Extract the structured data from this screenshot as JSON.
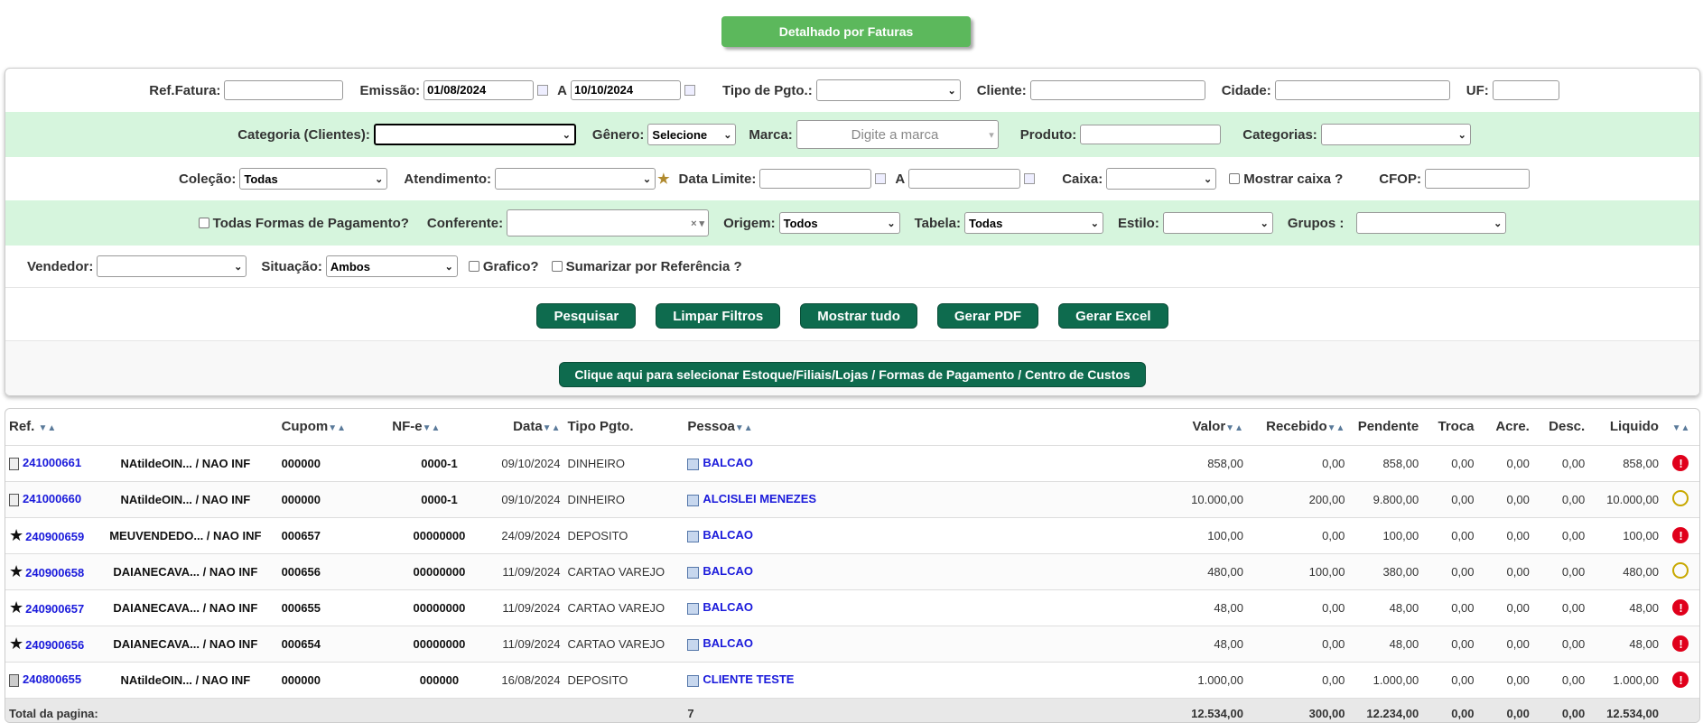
{
  "top_button": "Detalhado por Faturas",
  "filters": {
    "ref_fatura": "Ref.Fatura:",
    "emissao": "Emissão:",
    "emissao_de": "01/08/2024",
    "a": "A",
    "emissao_ate": "10/10/2024",
    "tipo_pgto": "Tipo de Pgto.:",
    "cliente": "Cliente:",
    "cidade": "Cidade:",
    "uf": "UF:",
    "categoria_clientes": "Categoria (Clientes):",
    "genero": "Gênero:",
    "genero_value": "Selecione",
    "marca": "Marca:",
    "marca_placeholder": "Digite a marca",
    "produto": "Produto:",
    "categorias": "Categorias:",
    "colecao": "Coleção:",
    "colecao_value": "Todas",
    "atendimento": "Atendimento:",
    "data_limite": "Data Limite:",
    "caixa": "Caixa:",
    "mostrar_caixa": "Mostrar caixa ?",
    "cfop": "CFOP:",
    "todas_formas": "Todas Formas de Pagamento?",
    "conferente": "Conferente:",
    "origem": "Origem:",
    "origem_value": "Todos",
    "tabela": "Tabela:",
    "tabela_value": "Todas",
    "estilo": "Estilo:",
    "grupos": "Grupos :",
    "vendedor": "Vendedor:",
    "situacao": "Situação:",
    "situacao_value": "Ambos",
    "grafico": "Grafico?",
    "sumarizar": "Sumarizar por Referência ?"
  },
  "actions": {
    "pesquisar": "Pesquisar",
    "limpar": "Limpar Filtros",
    "mostrar_tudo": "Mostrar tudo",
    "gerar_pdf": "Gerar PDF",
    "gerar_excel": "Gerar Excel",
    "selecionar": "Clique aqui para selecionar Estoque/Filiais/Lojas / Formas de Pagamento / Centro de Custos"
  },
  "table": {
    "headers": {
      "ref": "Ref.",
      "cupom": "Cupom",
      "nfe": "NF-e",
      "data": "Data",
      "tipo": "Tipo Pgto.",
      "pessoa": "Pessoa",
      "valor": "Valor",
      "recebido": "Recebido",
      "pendente": "Pendente",
      "troca": "Troca",
      "acre": "Acre.",
      "desc": "Desc.",
      "liquido": "Liquido"
    },
    "rows": [
      {
        "icon": "document",
        "ref": "241000661",
        "vend": "NAtildeOIN... / NAO INF",
        "cupom": "000000",
        "nfe": "0000-1",
        "data": "09/10/2024",
        "tipo": "DINHEIRO",
        "pessoa": "BALCAO",
        "valor": "858,00",
        "recebido": "0,00",
        "pendente": "858,00",
        "troca": "0,00",
        "acre": "0,00",
        "desc": "0,00",
        "liquido": "858,00",
        "status": "red"
      },
      {
        "icon": "document",
        "ref": "241000660",
        "vend": "NAtildeOIN... / NAO INF",
        "cupom": "000000",
        "nfe": "0000-1",
        "data": "09/10/2024",
        "tipo": "DINHEIRO",
        "pessoa": "ALCISLEI MENEZES",
        "valor": "10.000,00",
        "recebido": "200,00",
        "pendente": "9.800,00",
        "troca": "0,00",
        "acre": "0,00",
        "desc": "0,00",
        "liquido": "10.000,00",
        "status": "yellow"
      },
      {
        "icon": "star",
        "ref": "240900659",
        "vend": "MEUVENDEDO... / NAO INF",
        "cupom": "000657",
        "nfe": "00000000",
        "data": "24/09/2024",
        "tipo": "DEPOSITO",
        "pessoa": "BALCAO",
        "valor": "100,00",
        "recebido": "0,00",
        "pendente": "100,00",
        "troca": "0,00",
        "acre": "0,00",
        "desc": "0,00",
        "liquido": "100,00",
        "status": "red"
      },
      {
        "icon": "star",
        "ref": "240900658",
        "vend": "DAIANECAVA... / NAO INF",
        "cupom": "000656",
        "nfe": "00000000",
        "data": "11/09/2024",
        "tipo": "CARTAO VAREJO",
        "pessoa": "BALCAO",
        "valor": "480,00",
        "recebido": "100,00",
        "pendente": "380,00",
        "troca": "0,00",
        "acre": "0,00",
        "desc": "0,00",
        "liquido": "480,00",
        "status": "yellow"
      },
      {
        "icon": "star",
        "ref": "240900657",
        "vend": "DAIANECAVA... / NAO INF",
        "cupom": "000655",
        "nfe": "00000000",
        "data": "11/09/2024",
        "tipo": "CARTAO VAREJO",
        "pessoa": "BALCAO",
        "valor": "48,00",
        "recebido": "0,00",
        "pendente": "48,00",
        "troca": "0,00",
        "acre": "0,00",
        "desc": "0,00",
        "liquido": "48,00",
        "status": "red"
      },
      {
        "icon": "star",
        "ref": "240900656",
        "vend": "DAIANECAVA... / NAO INF",
        "cupom": "000654",
        "nfe": "00000000",
        "data": "11/09/2024",
        "tipo": "CARTAO VAREJO",
        "pessoa": "BALCAO",
        "valor": "48,00",
        "recebido": "0,00",
        "pendente": "48,00",
        "troca": "0,00",
        "acre": "0,00",
        "desc": "0,00",
        "liquido": "48,00",
        "status": "red"
      },
      {
        "icon": "receipt",
        "ref": "240800655",
        "vend": "NAtildeOIN... / NAO INF",
        "cupom": "000000",
        "nfe": "000000",
        "data": "16/08/2024",
        "tipo": "DEPOSITO",
        "pessoa": "CLIENTE TESTE",
        "valor": "1.000,00",
        "recebido": "0,00",
        "pendente": "1.000,00",
        "troca": "0,00",
        "acre": "0,00",
        "desc": "0,00",
        "liquido": "1.000,00",
        "status": "red"
      }
    ],
    "total": {
      "label": "Total da pagina:",
      "count": "7",
      "valor": "12.534,00",
      "recebido": "300,00",
      "pendente": "12.234,00",
      "troca": "0,00",
      "acre": "0,00",
      "desc": "0,00",
      "liquido": "12.534,00"
    }
  }
}
